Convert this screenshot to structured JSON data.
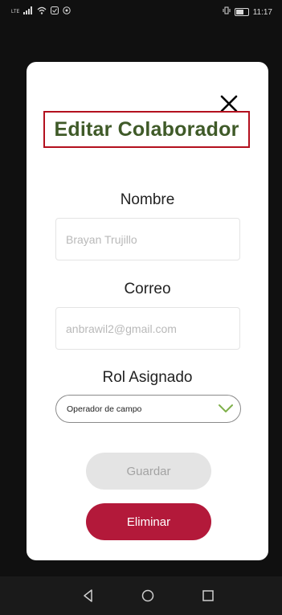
{
  "status_bar": {
    "left_icons": [
      "lte-icon",
      "signal-icon",
      "wifi-icon",
      "notification-icon",
      "whatsapp-icon"
    ],
    "right_icons": [
      "vibrate-icon",
      "battery-icon"
    ],
    "time": "11:17"
  },
  "modal": {
    "title": "Editar Colaborador",
    "name_label": "Nombre",
    "name_value": "Brayan Trujillo",
    "email_label": "Correo",
    "email_value": "anbrawil2@gmail.com",
    "role_label": "Rol Asignado",
    "role_selected": "Operador de campo",
    "save_label": "Guardar",
    "delete_label": "Eliminar"
  },
  "colors": {
    "title": "#3f5a28",
    "title_border": "#b3101e",
    "delete_button": "#b3193a",
    "save_button": "#e4e4e4",
    "chevron": "#7fb04a"
  },
  "nav_bar": {
    "icons": [
      "back-icon",
      "home-icon",
      "recents-icon"
    ]
  }
}
